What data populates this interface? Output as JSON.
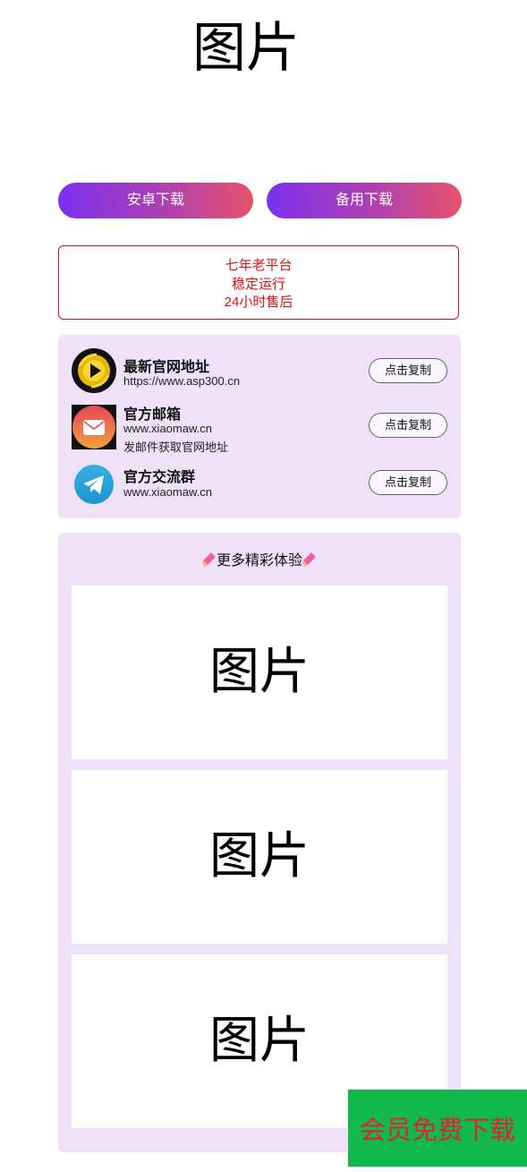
{
  "hero": {
    "image_placeholder": "图片"
  },
  "buttons": {
    "android_download": "安卓下载",
    "backup_download": "备用下载"
  },
  "notice": {
    "line1": "七年老平台",
    "line2": "稳定运行",
    "line3": "24小时售后"
  },
  "links": [
    {
      "title": "最新官网地址",
      "sub": "https://www.asp300.cn",
      "sub2": "",
      "button": "点击复制",
      "icon": "play-logo-icon"
    },
    {
      "title": "官方邮箱",
      "sub": "www.xiaomaw.cn",
      "sub2": "发邮件获取官网地址",
      "button": "点击复制",
      "icon": "mail-icon"
    },
    {
      "title": "官方交流群",
      "sub": "www.xiaomaw.cn",
      "sub2": "",
      "button": "点击复制",
      "icon": "telegram-icon"
    }
  ],
  "more": {
    "header": "更多精彩体验",
    "images": [
      "图片",
      "图片",
      "图片"
    ]
  },
  "vip": {
    "label": "会员免费下载"
  },
  "colors": {
    "gradient_start": "#7b2ff0",
    "gradient_end": "#e8526c",
    "notice_red": "#e01010",
    "panel_bg": "#efe2f8",
    "vip_bg": "#10b94a",
    "vip_text": "#e0213a"
  }
}
